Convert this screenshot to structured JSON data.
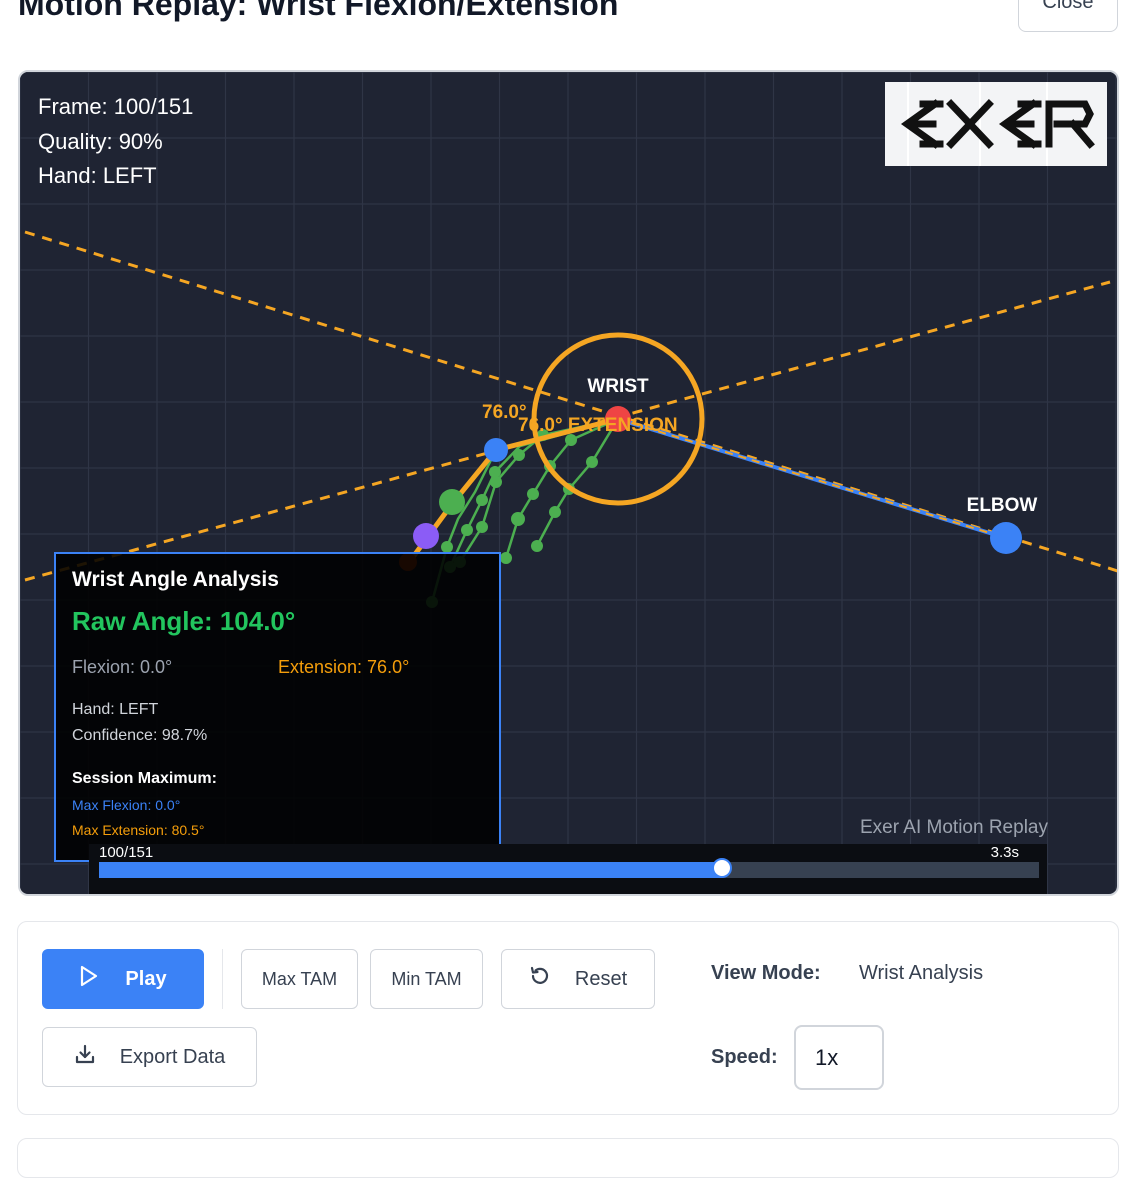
{
  "header": {
    "title": "Motion Replay: Wrist Flexion/Extension",
    "close_label": "Close"
  },
  "overlay": {
    "frame_text": "Frame: 100/151",
    "quality_text": "Quality: 90%",
    "hand_text": "Hand: LEFT",
    "logo_text": "EXER",
    "replay_label": "Exer AI Motion Replay"
  },
  "skeleton": {
    "wrist_label": "WRIST",
    "elbow_label": "ELBOW",
    "angle_label": "76.0°",
    "extension_label": "76.0° EXTENSION"
  },
  "analysis": {
    "title": "Wrist Angle Analysis",
    "raw_angle": "Raw Angle: 104.0°",
    "flexion": "Flexion: 0.0°",
    "extension": "Extension: 76.0°",
    "hand": "Hand: LEFT",
    "confidence": "Confidence: 98.7%",
    "session_title": "Session Maximum:",
    "max_flexion": "Max Flexion: 0.0°",
    "max_extension": "Max Extension: 80.5°"
  },
  "timeline": {
    "frame_label": "100/151",
    "time_label": "3.3s",
    "current_frame": 100,
    "total_frames": 151
  },
  "controls": {
    "play_label": "Play",
    "max_tam_label": "Max TAM",
    "min_tam_label": "Min TAM",
    "reset_label": "Reset",
    "export_label": "Export Data",
    "view_mode_label": "View Mode:",
    "view_mode_value": "Wrist Analysis",
    "speed_label": "Speed:",
    "speed_value": "1x"
  },
  "colors": {
    "accent": "#3b82f6",
    "angle_orange": "#f5a623",
    "finger_green": "#4caf50",
    "wrist_red": "#ef4444",
    "canvas_bg": "#1f2433"
  },
  "icons": {
    "play": "play-icon",
    "reset": "reset-icon",
    "export": "download-icon"
  }
}
